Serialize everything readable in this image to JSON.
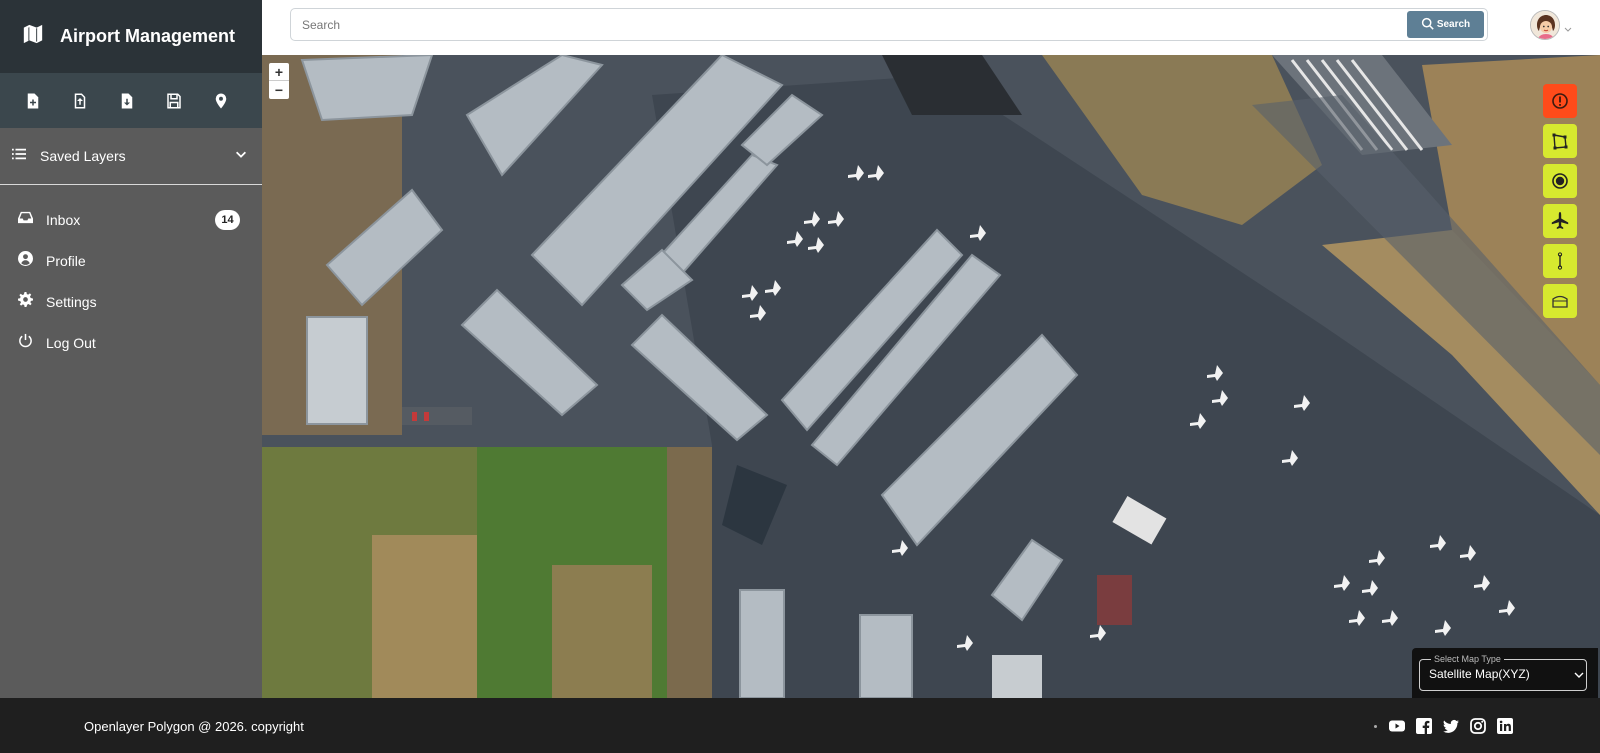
{
  "app": {
    "title": "Airport Management"
  },
  "toolbar": {
    "icons": [
      "new-file-icon",
      "upload-file-icon",
      "download-file-icon",
      "save-icon",
      "location-pin-icon"
    ]
  },
  "sidebar": {
    "saved_layers": "Saved Layers",
    "items": [
      {
        "label": "Inbox",
        "icon": "inbox-icon",
        "badge": "14"
      },
      {
        "label": "Profile",
        "icon": "user-icon"
      },
      {
        "label": "Settings",
        "icon": "gear-icon"
      },
      {
        "label": "Log Out",
        "icon": "power-icon"
      }
    ]
  },
  "search": {
    "placeholder": "Search",
    "button_label": "Search"
  },
  "map": {
    "zoom_in": "+",
    "zoom_out": "−",
    "tools": [
      "info-icon",
      "polygon-icon",
      "circle-icon",
      "airplane-icon",
      "line-icon",
      "hangar-icon"
    ],
    "map_type_legend": "Select Map Type",
    "map_type_value": "Satellite Map(XYZ)"
  },
  "footer": {
    "copyright": "Openlayer Polygon @ 2026. copyright",
    "social": [
      "youtube-icon",
      "facebook-icon",
      "twitter-icon",
      "instagram-icon",
      "linkedin-icon"
    ]
  },
  "colors": {
    "sidebar_bg": "#5b5b5b",
    "brand_bg": "#2b3338",
    "toolbar_bg": "#3b474d",
    "search_button": "#5e7f95",
    "tool_yellow": "#d7e92f",
    "tool_red": "#ff4b1a",
    "footer_bg": "#1f1f1f"
  }
}
